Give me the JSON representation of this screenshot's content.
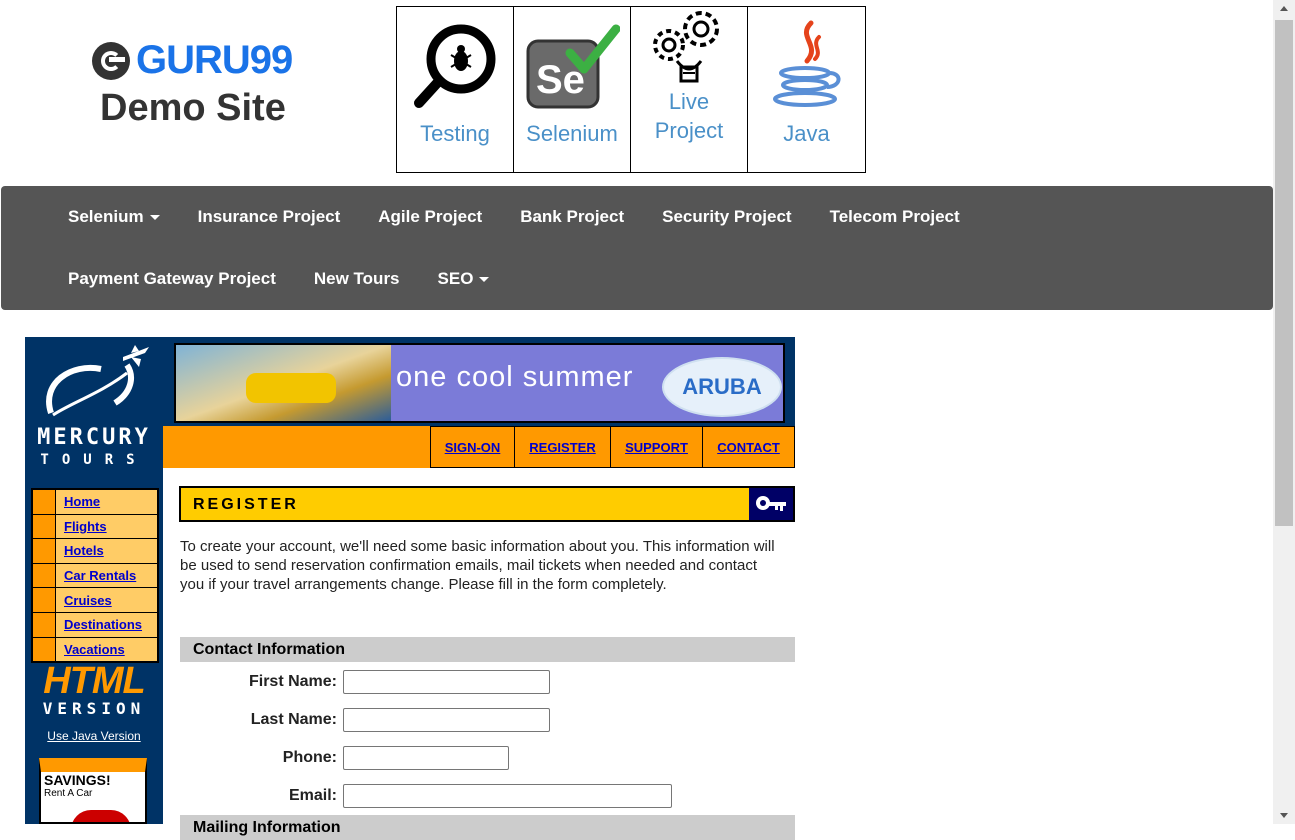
{
  "header": {
    "logo_text": "GURU99",
    "demo_text": "Demo Site",
    "tiles": [
      {
        "label": "Testing",
        "icon": "magnifier-bug-icon"
      },
      {
        "label": "Selenium",
        "icon": "selenium-icon"
      },
      {
        "label": "Live\nProject",
        "icon": "gears-bulb-icon"
      },
      {
        "label": "Java",
        "icon": "java-icon"
      }
    ]
  },
  "nav": {
    "selenium": "Selenium",
    "insurance": "Insurance Project",
    "agile": "Agile Project",
    "bank": "Bank Project",
    "security": "Security Project",
    "telecom": "Telecom Project",
    "payment": "Payment Gateway Project",
    "newtours": "New Tours",
    "seo": "SEO"
  },
  "mercury": {
    "brand_line1": "MERCURY",
    "brand_line2": "TOURS",
    "banner_text": "one cool summer",
    "banner_brand": "ARUBA",
    "top_links": {
      "signon": "SIGN-ON",
      "register": "REGISTER",
      "support": "SUPPORT",
      "contact": "CONTACT"
    },
    "sidebar": [
      "Home",
      "Flights",
      "Hotels",
      "Car Rentals",
      "Cruises",
      "Destinations",
      "Vacations"
    ],
    "html_version_1": "HTML",
    "html_version_2": "VERSION",
    "java_link": "Use Java Version",
    "savings_1": "SAVINGS!",
    "savings_2": "Rent A Car",
    "register_title": "REGISTER",
    "intro": "To create your account, we'll need some basic information about you. This information will be used to send reservation confirmation emails, mail tickets when needed and contact you if your travel arrangements change. Please fill in the form completely.",
    "contact_section": "Contact Information",
    "mailing_section": "Mailing Information",
    "fields": {
      "first_name": {
        "label": "First Name:",
        "value": ""
      },
      "last_name": {
        "label": "Last Name:",
        "value": ""
      },
      "phone": {
        "label": "Phone:",
        "value": ""
      },
      "email": {
        "label": "Email:",
        "value": ""
      }
    }
  },
  "colors": {
    "navbar": "#555555",
    "mercury_blue": "#003366",
    "mercury_orange": "#ff9900",
    "register_yellow": "#ffcc00",
    "link_blue": "#0000cc"
  }
}
